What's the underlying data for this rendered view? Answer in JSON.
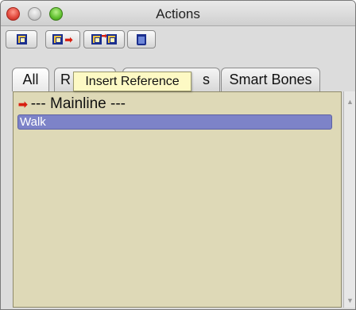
{
  "window": {
    "title": "Actions"
  },
  "toolbar": {
    "buttons": [
      {
        "icon": "new-action-icon"
      },
      {
        "icon": "insert-action-icon"
      },
      {
        "icon": "insert-reference-icon"
      },
      {
        "icon": "trash-icon"
      }
    ]
  },
  "tabs": [
    {
      "label": "All"
    },
    {
      "label": "R"
    },
    {
      "label": "s"
    },
    {
      "label": "Smart Bones"
    }
  ],
  "tooltip": {
    "text": "Insert Reference"
  },
  "list": {
    "mainline": "--- Mainline ---",
    "items": [
      {
        "label": "Walk",
        "selected": true
      }
    ]
  },
  "scrollbar": {
    "up": "▲",
    "down": "▼"
  },
  "colors": {
    "selection": "#7d83c8",
    "list_background": "#ded9b7",
    "tooltip_background": "#fdf9c4",
    "arrow": "#d81e10"
  }
}
